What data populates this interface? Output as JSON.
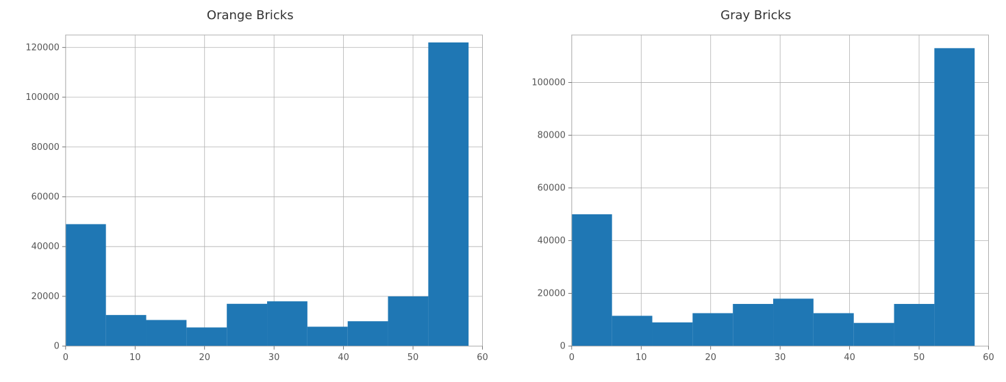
{
  "chart_data": [
    {
      "type": "bar",
      "title": "Orange Bricks",
      "xlabel": "",
      "ylabel": "",
      "xlim": [
        0,
        60
      ],
      "ylim": [
        0,
        125000
      ],
      "xticks": [
        0,
        10,
        20,
        30,
        40,
        50,
        60
      ],
      "yticks": [
        0,
        20000,
        40000,
        60000,
        80000,
        100000,
        120000
      ],
      "ytick_labels": [
        "0",
        "20000",
        "40000",
        "60000",
        "80000",
        "100000",
        "120000"
      ],
      "bin_width": 5.8,
      "categories": [
        0,
        5.8,
        11.6,
        17.4,
        23.2,
        29.0,
        34.8,
        40.6,
        46.4,
        52.2
      ],
      "values": [
        49000,
        12500,
        10500,
        7500,
        17000,
        18000,
        7800,
        10000,
        20000,
        122000
      ]
    },
    {
      "type": "bar",
      "title": "Gray Bricks",
      "xlabel": "",
      "ylabel": "",
      "xlim": [
        0,
        60
      ],
      "ylim": [
        0,
        118000
      ],
      "xticks": [
        0,
        10,
        20,
        30,
        40,
        50,
        60
      ],
      "yticks": [
        0,
        20000,
        40000,
        60000,
        80000,
        100000
      ],
      "ytick_labels": [
        "0",
        "20000",
        "40000",
        "60000",
        "80000",
        "100000"
      ],
      "bin_width": 5.8,
      "categories": [
        0,
        5.8,
        11.6,
        17.4,
        23.2,
        29.0,
        34.8,
        40.6,
        46.4,
        52.2
      ],
      "values": [
        50000,
        11500,
        9000,
        12500,
        16000,
        18000,
        12500,
        8800,
        16000,
        113000
      ]
    }
  ]
}
